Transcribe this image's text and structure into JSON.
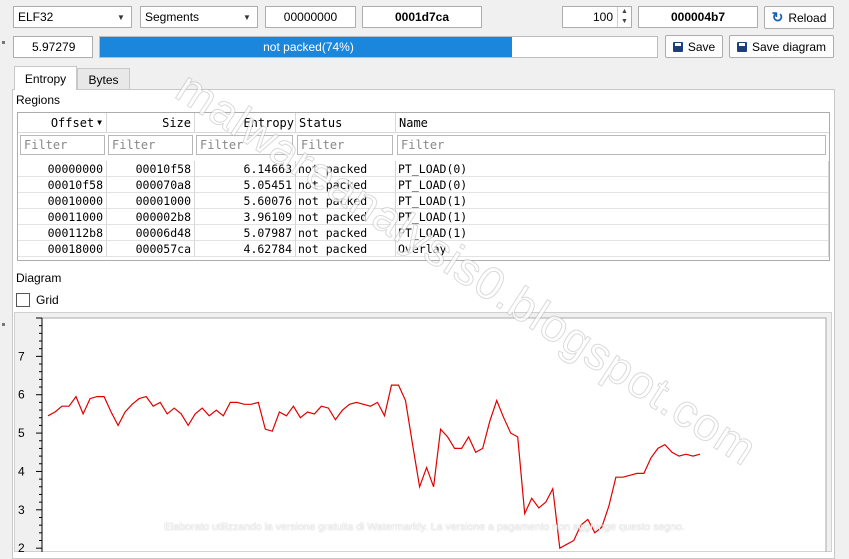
{
  "toolbar": {
    "format_value": "ELF32",
    "mode_value": "Segments",
    "offset_value": "00000000",
    "size_value": "0001d7ca",
    "block_count": "100",
    "hex_value": "000004b7",
    "reload_label": "Reload",
    "total_entropy": "5.97279",
    "progress_label": "not packed(74%)",
    "progress_fraction": 0.74,
    "save_label": "Save",
    "save_diagram_label": "Save diagram"
  },
  "tabs": [
    {
      "label": "Entropy",
      "active": true
    },
    {
      "label": "Bytes",
      "active": false
    }
  ],
  "regions": {
    "title": "Regions",
    "columns": [
      "Offset",
      "Size",
      "Entropy",
      "Status",
      "Name"
    ],
    "filter_placeholder": "Filter",
    "rows": [
      {
        "offset": "00000000",
        "size": "00010f58",
        "entropy": "6.14663",
        "status": "not packed",
        "name": "PT_LOAD(0)"
      },
      {
        "offset": "00010f58",
        "size": "000070a8",
        "entropy": "5.05451",
        "status": "not packed",
        "name": "PT_LOAD(0)"
      },
      {
        "offset": "00010000",
        "size": "00001000",
        "entropy": "5.60076",
        "status": "not packed",
        "name": "PT_LOAD(1)"
      },
      {
        "offset": "00011000",
        "size": "000002b8",
        "entropy": "3.96109",
        "status": "not packed",
        "name": "PT_LOAD(1)"
      },
      {
        "offset": "000112b8",
        "size": "00006d48",
        "entropy": "5.07987",
        "status": "not packed",
        "name": "PT_LOAD(1)"
      },
      {
        "offset": "00018000",
        "size": "000057ca",
        "entropy": "4.62784",
        "status": "not packed",
        "name": "Overlay"
      }
    ]
  },
  "diagram": {
    "title": "Diagram",
    "grid_label": "Grid",
    "grid_checked": false,
    "y_ticks": [
      "7",
      "6",
      "5",
      "4",
      "3",
      "2"
    ],
    "line_color": "#e00000",
    "values": [
      5.45,
      5.55,
      5.7,
      5.7,
      5.95,
      5.5,
      5.9,
      5.95,
      5.95,
      5.55,
      5.2,
      5.55,
      5.75,
      5.9,
      5.95,
      5.7,
      5.8,
      5.5,
      5.65,
      5.5,
      5.2,
      5.5,
      5.65,
      5.45,
      5.6,
      5.45,
      5.8,
      5.8,
      5.75,
      5.75,
      5.8,
      5.1,
      5.05,
      5.55,
      5.45,
      5.7,
      5.4,
      5.55,
      5.5,
      5.7,
      5.65,
      5.35,
      5.6,
      5.75,
      5.8,
      5.75,
      5.7,
      5.8,
      5.45,
      6.25,
      6.25,
      5.85,
      4.7,
      3.6,
      4.1,
      3.6,
      5.1,
      4.9,
      4.6,
      4.6,
      4.9,
      4.5,
      4.6,
      5.3,
      5.85,
      5.4,
      5.0,
      4.9,
      2.9,
      3.3,
      3.05,
      3.2,
      3.55,
      2.0,
      2.1,
      2.2,
      2.6,
      2.75,
      2.4,
      2.55,
      3.1,
      3.85,
      3.85,
      3.9,
      3.95,
      3.95,
      4.35,
      4.6,
      4.7,
      4.5,
      4.4,
      4.45,
      4.4,
      4.45
    ],
    "ylim": [
      1.9,
      8.0
    ]
  },
  "watermark": {
    "diagonal": "malwareanalysis0.blogspot.com",
    "footer": "Elaborato utilizzando la versione gratuita di Watermarkly. La versione a pagamento non aggiunge questo segno."
  }
}
